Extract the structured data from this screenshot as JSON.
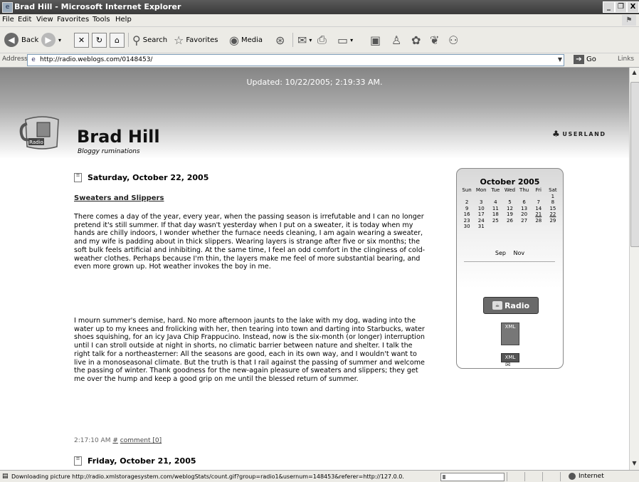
{
  "window": {
    "title": "Brad Hill - Microsoft Internet Explorer",
    "controls": {
      "minimize": "_",
      "maximize": "❐",
      "close": "X"
    }
  },
  "menu": [
    "File",
    "Edit",
    "View",
    "Favorites",
    "Tools",
    "Help"
  ],
  "toolbar": {
    "back_label": "Back",
    "search_label": "Search",
    "favorites_label": "Favorites",
    "media_label": "Media"
  },
  "address": {
    "label": "Address",
    "url": "http://radio.weblogs.com/0148453/",
    "go_label": "Go",
    "links_label": "Links"
  },
  "page": {
    "updated": "Updated: 10/22/2005; 2:19:33 AM.",
    "blog_title": "Brad Hill",
    "tagline": "Bloggy ruminations",
    "userland": "USERLAND",
    "day1": "Saturday, October 22, 2005",
    "post_title": "Sweaters and Slippers",
    "para1": "There comes a day of the year, every year, when the passing season is irrefutable and I can no longer pretend it's still summer. If that day wasn't yesterday when I put on a sweater, it is today when my hands are chilly indoors, I wonder whether the furnace needs cleaning, I am again wearing a sweater, and my wife is padding about in thick slippers. Wearing layers is strange after five or six months; the soft bulk feels artificial and inhibiting. At the same time, I feel an odd comfort in the clinginess of cold-weather clothes. Perhaps because I'm thin, the layers make me feel of more substantial bearing, and even more grown up. Hot weather invokes the boy in me.",
    "para2": "I mourn summer's demise, hard. No more afternoon jaunts to the lake with my dog, wading into the water up to my knees and frolicking with her, then tearing into town and darting into Starbucks, water shoes squishing, for an icy Java Chip Frappucino. Instead, now is the six-month (or longer) interruption until I can stroll outside at night in shorts, no climatic barrier between nature and shelter. I talk the right talk for a northeasterner: All the seasons are good, each in its own way, and I wouldn't want to live in a monoseasonal climate. But the truth is that I rail against the passing of summer and welcome the passing of winter. Thank goodness for the new-again pleasure of sweaters and slippers; they get me over the hump and keep a good grip on me until the blessed return of summer.",
    "timestamp": "2:17:10 AM",
    "permalink": "#",
    "comment": "comment [0]",
    "day2": "Friday, October 21, 2005"
  },
  "calendar": {
    "month": "October 2005",
    "days_header": [
      "Sun",
      "Mon",
      "Tue",
      "Wed",
      "Thu",
      "Fri",
      "Sat"
    ],
    "weeks": [
      [
        "",
        "",
        "",
        "",
        "",
        "",
        "1"
      ],
      [
        "2",
        "3",
        "4",
        "5",
        "6",
        "7",
        "8"
      ],
      [
        "9",
        "10",
        "11",
        "12",
        "13",
        "14",
        "15"
      ],
      [
        "16",
        "17",
        "18",
        "19",
        "20",
        "21",
        "22"
      ],
      [
        "23",
        "24",
        "25",
        "26",
        "27",
        "28",
        "29"
      ],
      [
        "30",
        "31",
        "",
        "",
        "",
        "",
        ""
      ]
    ],
    "linked_days": [
      "21",
      "22"
    ],
    "prev": "Sep",
    "next": "Nov",
    "radio_badge": "Radio",
    "xml_label": "XML",
    "mail_icon": "✉"
  },
  "status": {
    "message": "Downloading picture http://radio.xmlstoragesystem.com/weblogStats/count.gif?group=radio1&usernum=148453&referer=http://127.0.0.",
    "progress": 0.05,
    "zone": "Internet"
  }
}
